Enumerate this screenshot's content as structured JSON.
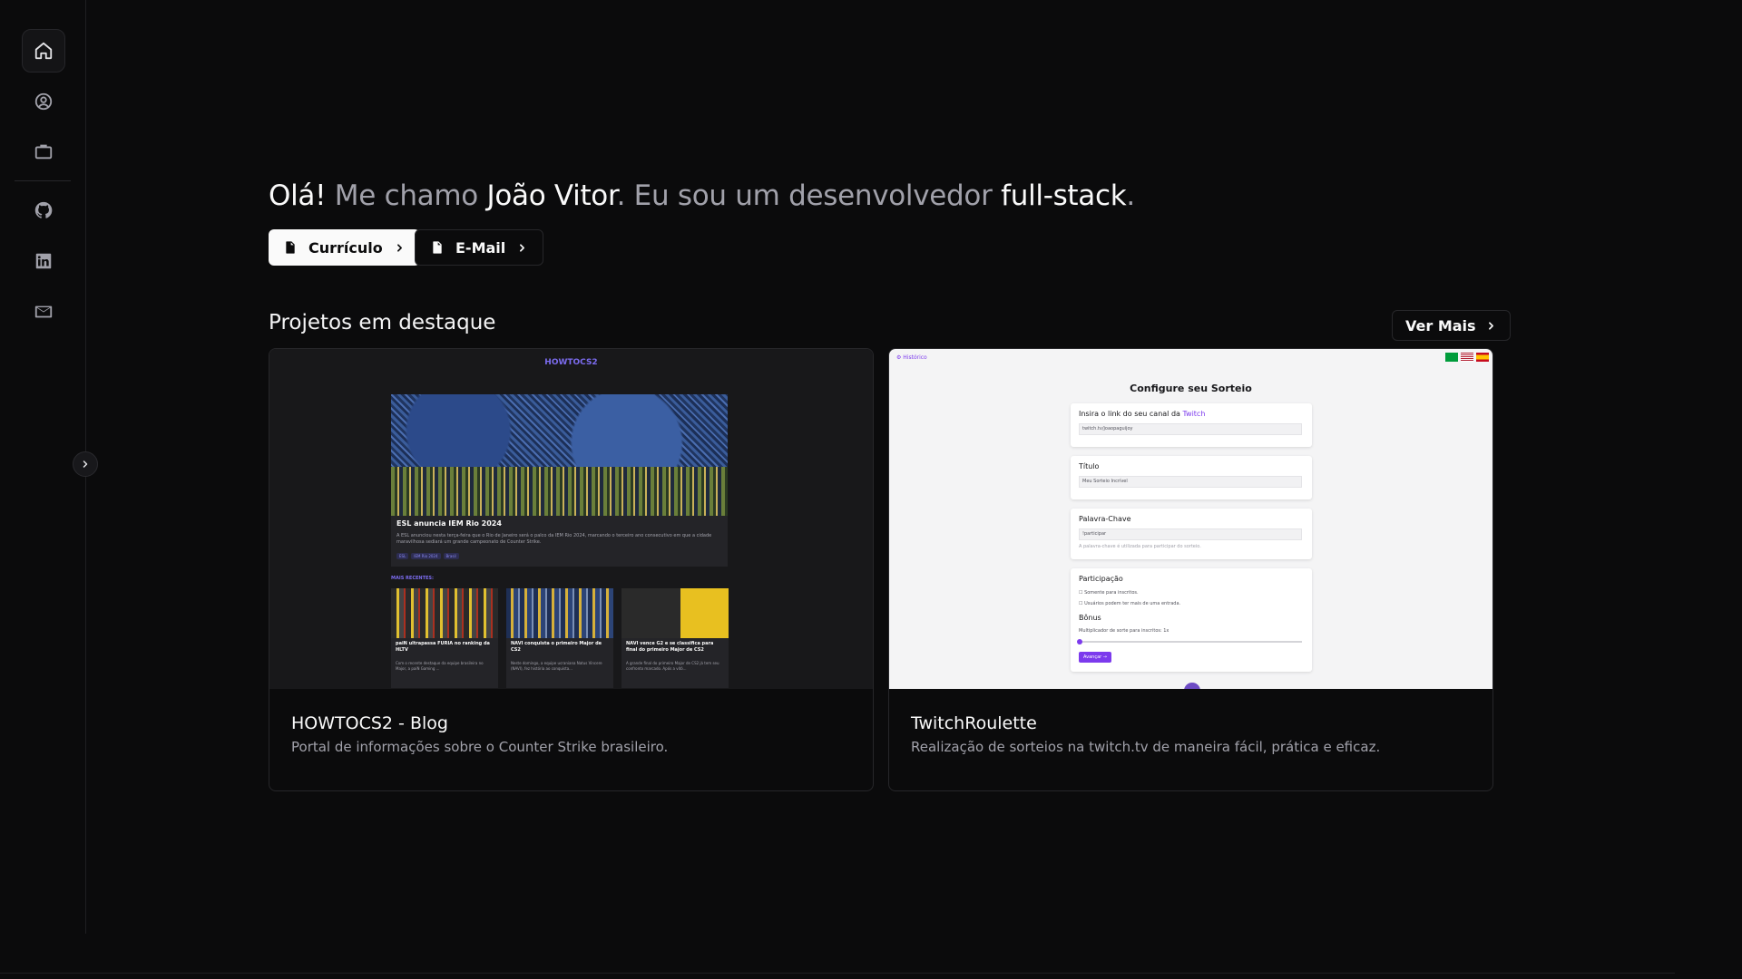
{
  "sidebar": {
    "items": [
      {
        "icon": "home-icon",
        "active": true
      },
      {
        "icon": "user-circle-icon"
      },
      {
        "icon": "briefcase-icon"
      },
      {
        "icon": "github-icon"
      },
      {
        "icon": "linkedin-icon"
      },
      {
        "icon": "mail-icon"
      }
    ],
    "expand_icon": "chevron-right-icon"
  },
  "hero": {
    "greeting": "Olá!",
    "part1": " Me chamo ",
    "name": "João Vitor",
    "part2": ". Eu sou um desenvolvedor ",
    "role": "full-stack",
    "end": "."
  },
  "buttons": {
    "resume": "Currículo",
    "email": "E-Mail"
  },
  "projects": {
    "title": "Projetos em destaque",
    "more": "Ver Mais",
    "items": [
      {
        "title": "HOWTOCS2 - Blog",
        "description": "Portal de informações sobre o Counter Strike brasileiro.",
        "preview": {
          "logo": "HOWTOCS2",
          "headline": "ESL anuncia IEM Rio 2024",
          "text": "A ESL anunciou nesta terça-feira que o Rio de Janeiro será o palco da IEM Rio 2024, marcando o terceiro ano consecutivo em que a cidade maravilhosa sediará um grande campeonato de Counter Strike.",
          "tags": [
            "ESL",
            "IEM Rio 2024",
            "Brasil"
          ],
          "section": "MAIS RECENTES:",
          "recent": [
            {
              "title": "paiN ultrapassa FURIA no ranking da HLTV",
              "text": "Com o recente destaque da equipe brasileira no Major, a paiN Gaming ..."
            },
            {
              "title": "NAVI conquista o primeiro Major de CS2",
              "text": "Neste domingo, a equipe ucraniana Natus Vincere (NAVI), fez história ao conquista..."
            },
            {
              "title": "NAVI vence G2 e se classifica para final do primeiro Major de CS2",
              "text": "A grande final do primeiro Major de CS2 já tem seu confronto marcado. Após a vitó..."
            }
          ]
        }
      },
      {
        "title": "TwitchRoulette",
        "description": "Realização de sorteios na twitch.tv de maneira fácil, prática e eficaz.",
        "preview": {
          "logo": "⚙ Histórico",
          "heading": "Configure seu Sorteio",
          "link_label": "Insira o link do seu canal da ",
          "link_brand": "Twitch",
          "link_value": "twitch.tv/joaopaguijoy",
          "title_label": "Título",
          "title_value": "Meu Sorteio Incrível",
          "keyword_label": "Palavra-Chave",
          "keyword_value": "!participar",
          "keyword_hint": "A palavra-chave é utilizada para participar do sorteio.",
          "participation_label": "Participação",
          "opt1": "Somente para inscritos.",
          "opt2": "Usuários podem ter mais de uma entrada.",
          "bonus_label": "Bônus",
          "bonus_text": "Multiplicador de sorte para inscritos: 1x",
          "button": "Avançar →"
        }
      }
    ]
  }
}
